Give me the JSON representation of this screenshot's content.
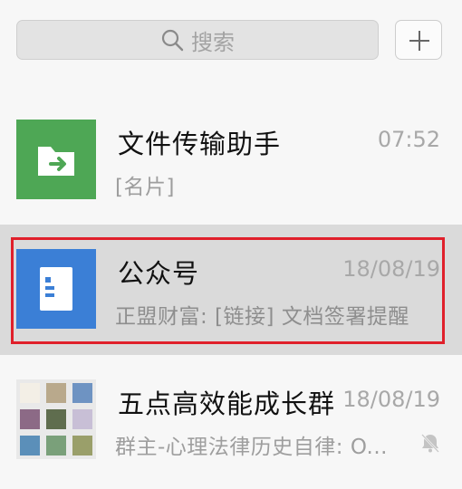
{
  "search": {
    "placeholder": "搜索"
  },
  "add_button": {
    "icon": "plus-icon"
  },
  "conversations": [
    {
      "title": "文件传输助手",
      "time": "07:52",
      "preview": "[名片]",
      "avatar_icon": "folder-arrow-icon",
      "avatar_color": "#4ea755"
    },
    {
      "title": "公众号",
      "time": "18/08/19",
      "preview": "正盟财富: [链接] 文档签署提醒",
      "avatar_icon": "document-icon",
      "avatar_color": "#3b7fd6",
      "highlighted": true,
      "highlight_color": "#e0202b"
    },
    {
      "title": "五点高效能成长群",
      "time": "18/08/19",
      "preview": "群主-心理法律历史自律: O...",
      "avatar_icon": "group-avatar-grid",
      "muted": true,
      "mute_icon": "mute-bell-icon"
    }
  ]
}
